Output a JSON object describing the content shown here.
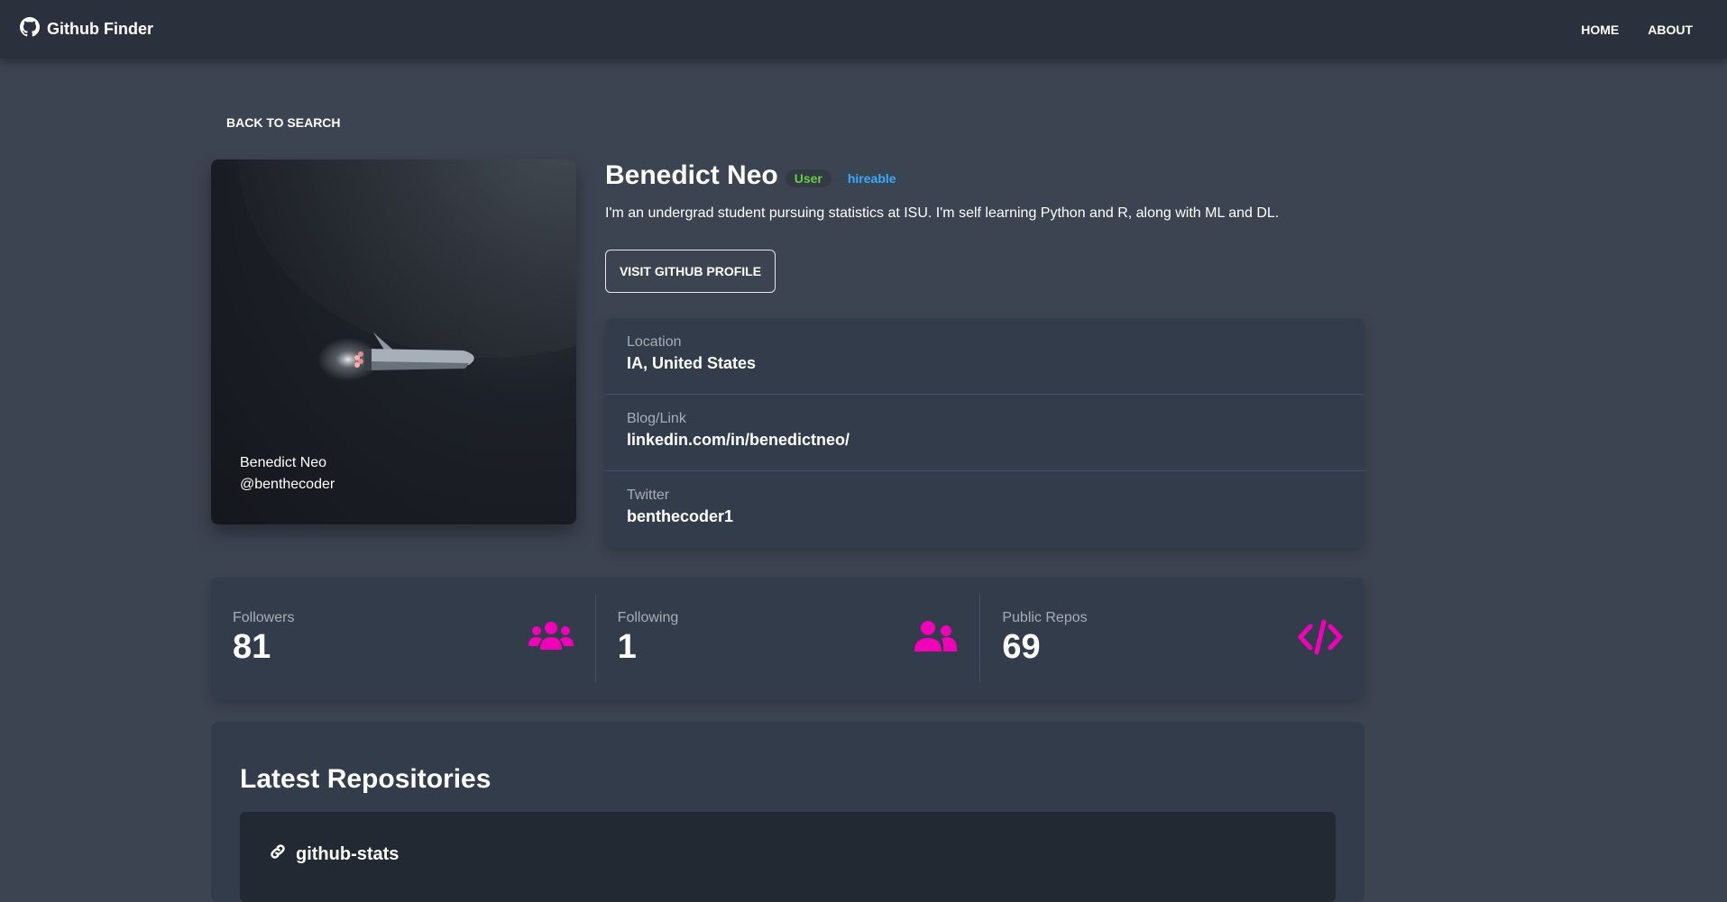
{
  "navbar": {
    "brand": "Github Finder",
    "links": [
      {
        "label": "HOME"
      },
      {
        "label": "ABOUT"
      }
    ]
  },
  "back_label": "BACK TO SEARCH",
  "user": {
    "name": "Benedict Neo",
    "login": "@benthecoder",
    "type_badge": "User",
    "hireable_badge": "hireable",
    "bio": "I'm an undergrad student pursuing statistics at ISU. I'm self learning Python and R, along with ML and DL.",
    "visit_label": "VISIT GITHUB PROFILE"
  },
  "info": [
    {
      "title": "Location",
      "value": "IA, United States"
    },
    {
      "title": "Blog/Link",
      "value": "linkedin.com/in/benedictneo/"
    },
    {
      "title": "Twitter",
      "value": "benthecoder1"
    }
  ],
  "stats": [
    {
      "title": "Followers",
      "value": "81",
      "icon": "users-icon"
    },
    {
      "title": "Following",
      "value": "1",
      "icon": "user-friends-icon"
    },
    {
      "title": "Public Repos",
      "value": "69",
      "icon": "code-icon"
    }
  ],
  "repos": {
    "title": "Latest Repositories",
    "items": [
      {
        "name": "github-stats",
        "icon": "link-icon"
      }
    ]
  },
  "colors": {
    "accent_pink": "#f000b8",
    "badge_user": "#66cc4a",
    "badge_hireable": "#3fa9f5",
    "background": "#3d4451",
    "card": "#333c4a",
    "navbar": "#2a303c"
  }
}
